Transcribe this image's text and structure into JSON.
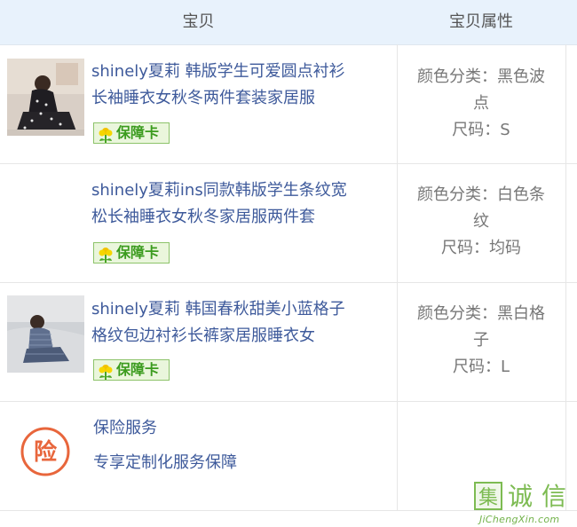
{
  "header": {
    "item_label": "宝贝",
    "attr_label": "宝贝属性"
  },
  "items": [
    {
      "title": "shinely夏莉 韩版学生可爱圆点衬衫长袖睡衣女秋冬两件套装家居服",
      "title_line1": "shinely夏莉 韩版学生可爱圆点衬衫",
      "title_line2": "长袖睡衣女秋冬两件套装家居服",
      "badge": "保障卡",
      "color_line1": "颜色分类：黑色波",
      "color_line2": "点",
      "size": "尺码：S",
      "has_thumb": true
    },
    {
      "title": "shinely夏莉ins同款韩版学生条纹宽松长袖睡衣女秋冬家居服两件套",
      "title_line1": "shinely夏莉ins同款韩版学生条纹宽",
      "title_line2": "松长袖睡衣女秋冬家居服两件套",
      "badge": "保障卡",
      "color_line1": "颜色分类：白色条",
      "color_line2": "纹",
      "size": "尺码：均码",
      "has_thumb": false
    },
    {
      "title": "shinely夏莉 韩国春秋甜美小蓝格子格纹包边衬衫长裤家居服睡衣女",
      "title_line1": "shinely夏莉 韩国春秋甜美小蓝格子",
      "title_line2": "格纹包边衬衫长裤家居服睡衣女",
      "badge": "保障卡",
      "color_line1": "颜色分类：黑白格",
      "color_line2": "子",
      "size": "尺码：L",
      "has_thumb": true
    }
  ],
  "insurance": {
    "icon_char": "险",
    "title": "保险服务",
    "subtitle": "专享定制化服务保障"
  },
  "watermark": {
    "chars": "集诚信",
    "sub": "JiChengXin.com"
  },
  "colors": {
    "header_bg": "#e8f2fc",
    "link": "#3e5a9b",
    "badge_green": "#3b9b1e",
    "insurance_orange": "#e8663c",
    "watermark_green": "#7dbb52"
  }
}
